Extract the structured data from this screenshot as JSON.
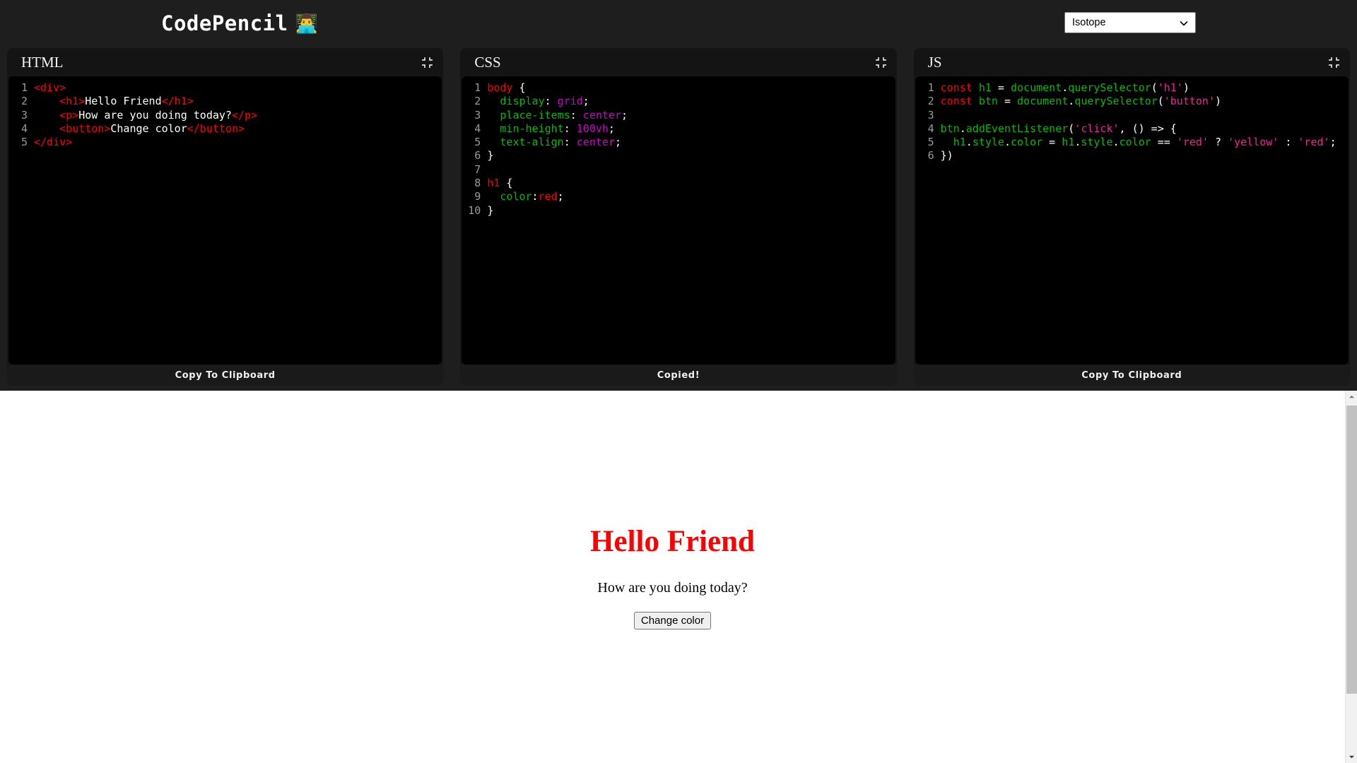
{
  "header": {
    "brand_title": "CodePencil",
    "brand_emoji": "👨‍💻",
    "theme_selected": "Isotope",
    "theme_options": [
      "Isotope"
    ],
    "chevron_icon": "chevron-down-icon"
  },
  "panels": [
    {
      "id": "html",
      "title": "HTML",
      "expand_icon": "compress-icon",
      "footer_label": "Copy To Clipboard",
      "lines": [
        {
          "n": "1",
          "tokens": [
            {
              "t": "<div>",
              "c": "t-tag"
            }
          ]
        },
        {
          "n": "2",
          "tokens": [
            {
              "t": "    ",
              "c": "t-txt"
            },
            {
              "t": "<h1>",
              "c": "t-tag"
            },
            {
              "t": "Hello Friend",
              "c": "t-txt"
            },
            {
              "t": "</h1>",
              "c": "t-tag"
            }
          ]
        },
        {
          "n": "3",
          "tokens": [
            {
              "t": "    ",
              "c": "t-txt"
            },
            {
              "t": "<p>",
              "c": "t-tag"
            },
            {
              "t": "How are you doing today?",
              "c": "t-txt"
            },
            {
              "t": "</p>",
              "c": "t-tag"
            }
          ]
        },
        {
          "n": "4",
          "tokens": [
            {
              "t": "    ",
              "c": "t-txt"
            },
            {
              "t": "<button>",
              "c": "t-tag"
            },
            {
              "t": "Change color",
              "c": "t-txt"
            },
            {
              "t": "</button>",
              "c": "t-tag"
            }
          ]
        },
        {
          "n": "5",
          "tokens": [
            {
              "t": "</div>",
              "c": "t-tag"
            }
          ]
        }
      ]
    },
    {
      "id": "css",
      "title": "CSS",
      "expand_icon": "compress-icon",
      "footer_label": "Copied!",
      "lines": [
        {
          "n": "1",
          "tokens": [
            {
              "t": "body",
              "c": "t-sel"
            },
            {
              "t": " {",
              "c": "t-punc"
            }
          ]
        },
        {
          "n": "2",
          "tokens": [
            {
              "t": "  ",
              "c": "t-punc"
            },
            {
              "t": "display",
              "c": "t-prop"
            },
            {
              "t": ": ",
              "c": "t-punc"
            },
            {
              "t": "grid",
              "c": "t-val"
            },
            {
              "t": ";",
              "c": "t-punc"
            }
          ]
        },
        {
          "n": "3",
          "tokens": [
            {
              "t": "  ",
              "c": "t-punc"
            },
            {
              "t": "place-items",
              "c": "t-prop"
            },
            {
              "t": ": ",
              "c": "t-punc"
            },
            {
              "t": "center",
              "c": "t-val"
            },
            {
              "t": ";",
              "c": "t-punc"
            }
          ]
        },
        {
          "n": "4",
          "tokens": [
            {
              "t": "  ",
              "c": "t-punc"
            },
            {
              "t": "min-height",
              "c": "t-prop"
            },
            {
              "t": ": ",
              "c": "t-punc"
            },
            {
              "t": "100vh",
              "c": "t-val"
            },
            {
              "t": ";",
              "c": "t-punc"
            }
          ]
        },
        {
          "n": "5",
          "tokens": [
            {
              "t": "  ",
              "c": "t-punc"
            },
            {
              "t": "text-align",
              "c": "t-prop"
            },
            {
              "t": ": ",
              "c": "t-punc"
            },
            {
              "t": "center",
              "c": "t-val"
            },
            {
              "t": ";",
              "c": "t-punc"
            }
          ]
        },
        {
          "n": "6",
          "tokens": [
            {
              "t": "}",
              "c": "t-punc"
            }
          ]
        },
        {
          "n": "7",
          "tokens": [
            {
              "t": "",
              "c": "t-punc"
            }
          ]
        },
        {
          "n": "8",
          "tokens": [
            {
              "t": "h1",
              "c": "t-sel"
            },
            {
              "t": " {",
              "c": "t-punc"
            }
          ]
        },
        {
          "n": "9",
          "tokens": [
            {
              "t": "  ",
              "c": "t-punc"
            },
            {
              "t": "color",
              "c": "t-prop"
            },
            {
              "t": ":",
              "c": "t-punc"
            },
            {
              "t": "red",
              "c": "t-red"
            },
            {
              "t": ";",
              "c": "t-punc"
            }
          ]
        },
        {
          "n": "10",
          "tokens": [
            {
              "t": "}",
              "c": "t-punc"
            }
          ]
        }
      ]
    },
    {
      "id": "js",
      "title": "JS",
      "expand_icon": "compress-icon",
      "footer_label": "Copy To Clipboard",
      "lines": [
        {
          "n": "1",
          "tokens": [
            {
              "t": "const",
              "c": "t-kw"
            },
            {
              "t": " ",
              "c": "t-punc"
            },
            {
              "t": "h1",
              "c": "t-ident"
            },
            {
              "t": " = ",
              "c": "t-punc"
            },
            {
              "t": "document",
              "c": "t-ident"
            },
            {
              "t": ".",
              "c": "t-punc"
            },
            {
              "t": "querySelector",
              "c": "t-ident"
            },
            {
              "t": "(",
              "c": "t-punc"
            },
            {
              "t": "'h1'",
              "c": "t-str"
            },
            {
              "t": ")",
              "c": "t-punc"
            }
          ]
        },
        {
          "n": "2",
          "tokens": [
            {
              "t": "const",
              "c": "t-kw"
            },
            {
              "t": " ",
              "c": "t-punc"
            },
            {
              "t": "btn",
              "c": "t-ident"
            },
            {
              "t": " = ",
              "c": "t-punc"
            },
            {
              "t": "document",
              "c": "t-ident"
            },
            {
              "t": ".",
              "c": "t-punc"
            },
            {
              "t": "querySelector",
              "c": "t-ident"
            },
            {
              "t": "(",
              "c": "t-punc"
            },
            {
              "t": "'button'",
              "c": "t-str"
            },
            {
              "t": ")",
              "c": "t-punc"
            }
          ]
        },
        {
          "n": "3",
          "tokens": [
            {
              "t": "",
              "c": "t-punc"
            }
          ]
        },
        {
          "n": "4",
          "tokens": [
            {
              "t": "btn",
              "c": "t-ident"
            },
            {
              "t": ".",
              "c": "t-punc"
            },
            {
              "t": "addEventListener",
              "c": "t-ident"
            },
            {
              "t": "(",
              "c": "t-punc"
            },
            {
              "t": "'click'",
              "c": "t-str"
            },
            {
              "t": ", () => {",
              "c": "t-punc"
            }
          ]
        },
        {
          "n": "5",
          "tokens": [
            {
              "t": "  ",
              "c": "t-punc"
            },
            {
              "t": "h1",
              "c": "t-ident"
            },
            {
              "t": ".",
              "c": "t-punc"
            },
            {
              "t": "style",
              "c": "t-ident"
            },
            {
              "t": ".",
              "c": "t-punc"
            },
            {
              "t": "color",
              "c": "t-ident"
            },
            {
              "t": " = ",
              "c": "t-punc"
            },
            {
              "t": "h1",
              "c": "t-ident"
            },
            {
              "t": ".",
              "c": "t-punc"
            },
            {
              "t": "style",
              "c": "t-ident"
            },
            {
              "t": ".",
              "c": "t-punc"
            },
            {
              "t": "color",
              "c": "t-ident"
            },
            {
              "t": " == ",
              "c": "t-punc"
            },
            {
              "t": "'red'",
              "c": "t-str"
            },
            {
              "t": " ? ",
              "c": "t-punc"
            },
            {
              "t": "'yellow'",
              "c": "t-str"
            },
            {
              "t": " : ",
              "c": "t-punc"
            },
            {
              "t": "'red'",
              "c": "t-str"
            },
            {
              "t": ";",
              "c": "t-punc"
            }
          ]
        },
        {
          "n": "6",
          "tokens": [
            {
              "t": "})",
              "c": "t-punc"
            }
          ]
        }
      ]
    }
  ],
  "preview": {
    "heading": "Hello Friend",
    "paragraph": "How are you doing today?",
    "button_label": "Change color",
    "heading_color": "#ff0000"
  },
  "scrollbar": {
    "up_icon": "triangle-up-icon",
    "down_icon": "triangle-down-icon",
    "thumb": "scrollbar-thumb"
  }
}
